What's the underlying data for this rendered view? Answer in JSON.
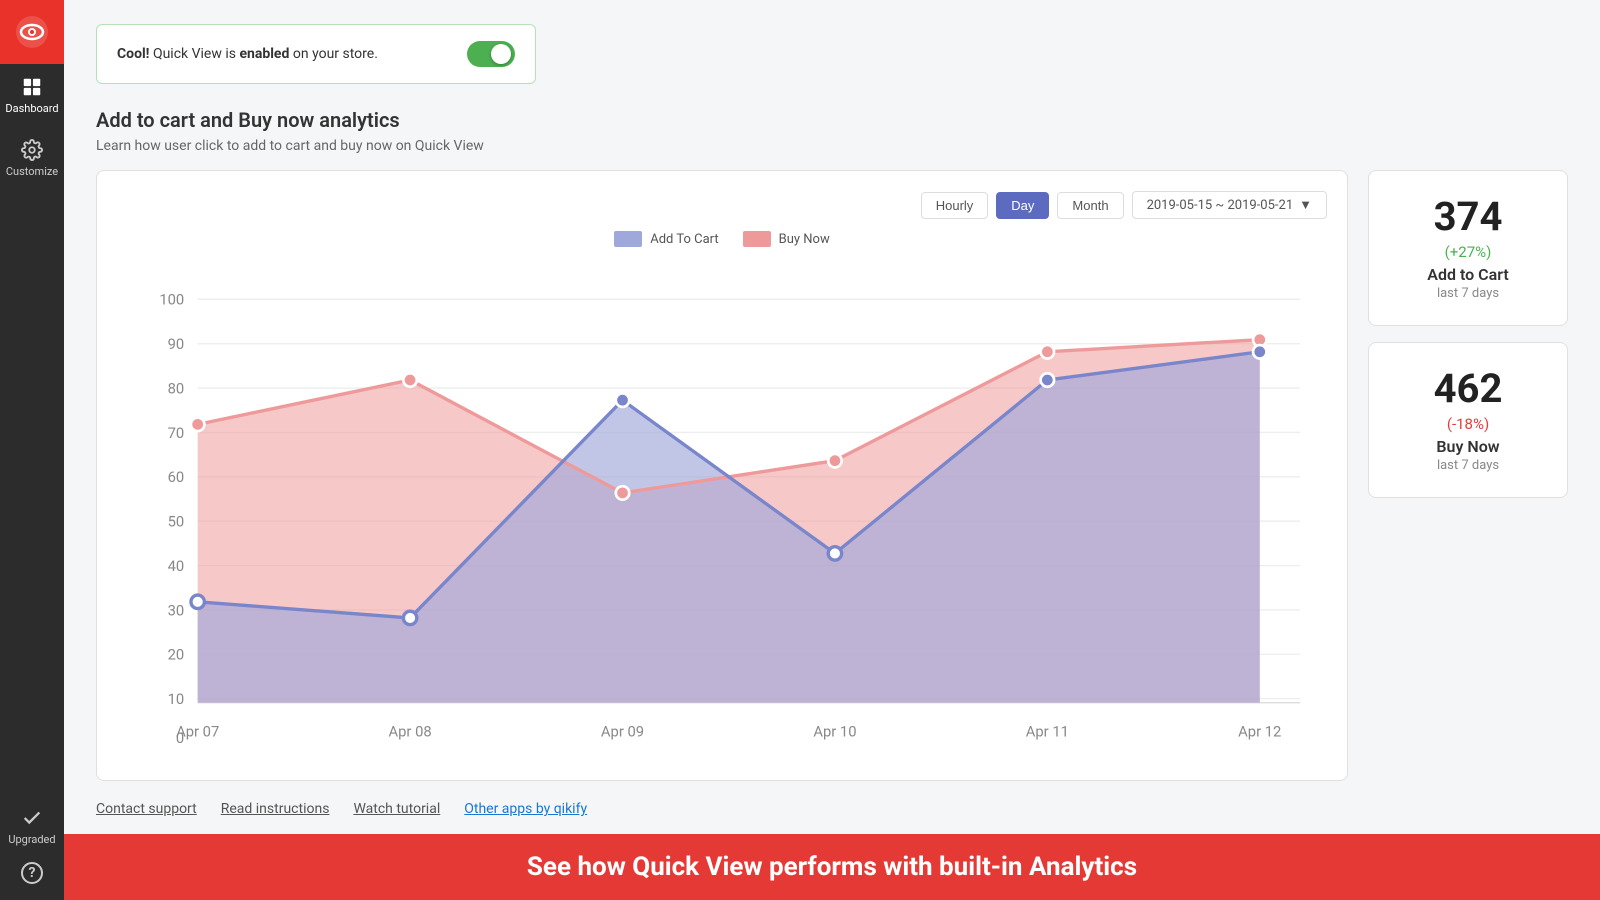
{
  "sidebar": {
    "logo_alt": "Qikify logo",
    "items": [
      {
        "id": "dashboard",
        "label": "Dashboard",
        "active": true
      },
      {
        "id": "customize",
        "label": "Customize",
        "active": false
      }
    ],
    "bottom_items": [
      {
        "id": "upgraded",
        "label": "Upgraded"
      },
      {
        "id": "help",
        "label": "?"
      }
    ]
  },
  "notification": {
    "text_prefix": "Cool!",
    "text_main": " Quick View is ",
    "text_bold": "enabled",
    "text_suffix": " on your store.",
    "toggle_state": true
  },
  "analytics": {
    "title": "Add to cart and Buy now analytics",
    "subtitle": "Learn how user click to add to cart and buy now on Quick View",
    "chart": {
      "time_buttons": [
        "Hourly",
        "Day",
        "Month"
      ],
      "active_time_button": "Day",
      "date_range": "2019-05-15 ~ 2019-05-21",
      "legend": [
        {
          "id": "add-to-cart",
          "label": "Add To Cart"
        },
        {
          "id": "buy-now",
          "label": "Buy Now"
        }
      ],
      "y_axis": [
        100,
        90,
        80,
        70,
        60,
        50,
        40,
        30,
        20,
        10,
        0
      ],
      "x_axis": [
        "Apr 07",
        "Apr 08",
        "Apr 09",
        "Apr 10",
        "Apr 11",
        "Apr 12"
      ],
      "add_to_cart_data": [
        25,
        21,
        75,
        37,
        80,
        87
      ],
      "buy_now_data": [
        70,
        80,
        52,
        60,
        87,
        90
      ]
    },
    "stats": [
      {
        "id": "add-to-cart",
        "number": "374",
        "change": "(+27%)",
        "change_type": "positive",
        "label": "Add to Cart",
        "period": "last 7 days"
      },
      {
        "id": "buy-now",
        "number": "462",
        "change": "(-18%)",
        "change_type": "negative",
        "label": "Buy Now",
        "period": "last 7 days"
      }
    ]
  },
  "footer": {
    "links": [
      {
        "id": "contact-support",
        "label": "Contact support",
        "highlight": false
      },
      {
        "id": "read-instructions",
        "label": "Read instructions",
        "highlight": false
      },
      {
        "id": "watch-tutorial",
        "label": "Watch tutorial",
        "highlight": false
      },
      {
        "id": "other-apps",
        "label": "Other apps by qikify",
        "highlight": true
      }
    ]
  },
  "bottom_banner": {
    "text": "See how Quick View performs with built-in Analytics"
  }
}
